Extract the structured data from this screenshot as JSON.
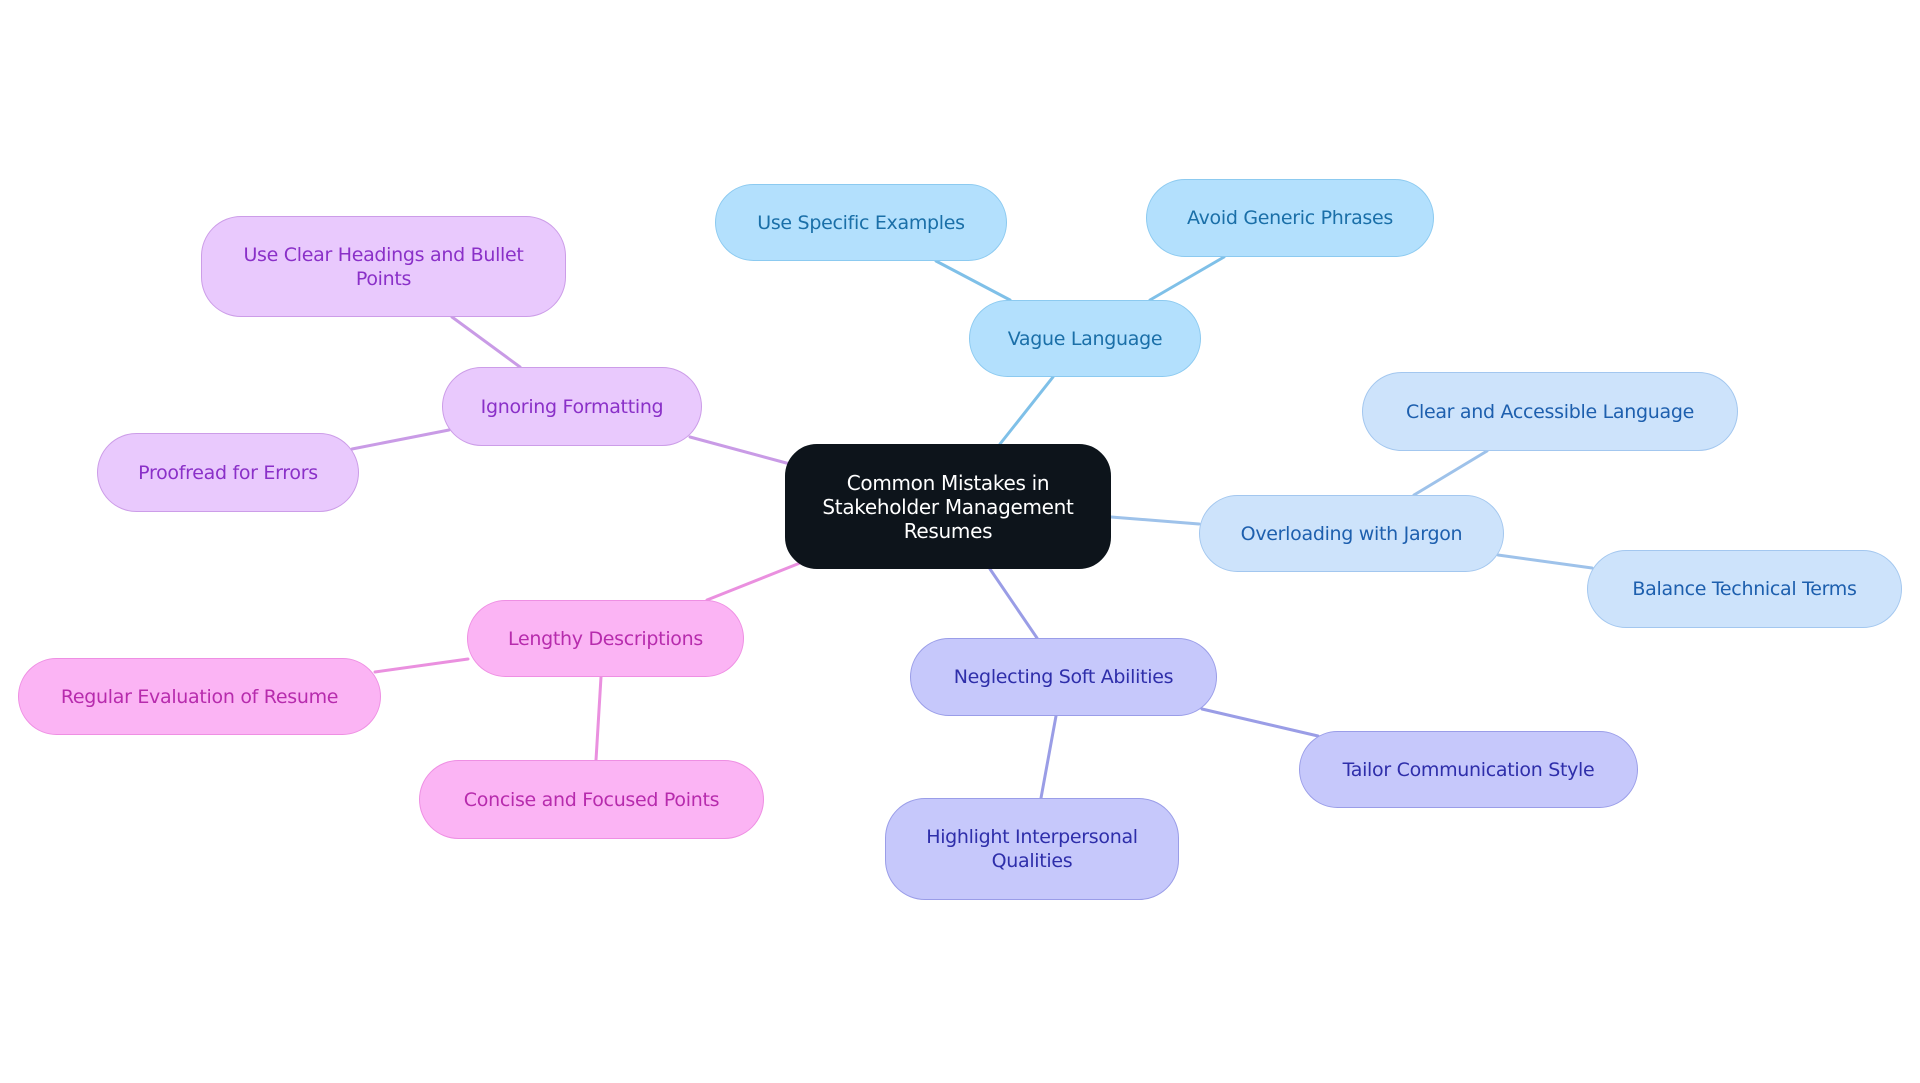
{
  "diagram": {
    "type": "mindmap",
    "root": {
      "id": "root",
      "label": "Common Mistakes in Stakeholder Management Resumes",
      "fill": "#0d141b",
      "text_color": "#ffffff",
      "border": "#0d141b"
    },
    "branches": [
      {
        "id": "vague",
        "label": "Vague Language",
        "fill": "#b3e0fd",
        "border": "#8ccaf0",
        "text_color": "#1a6fa8",
        "edge_color": "#7fc0e8",
        "children": [
          {
            "id": "vague-1",
            "label": "Use Specific Examples"
          },
          {
            "id": "vague-2",
            "label": "Avoid Generic Phrases"
          }
        ]
      },
      {
        "id": "jargon",
        "label": "Overloading with Jargon",
        "fill": "#cde3fb",
        "border": "#a3c7ef",
        "text_color": "#1d5fae",
        "edge_color": "#9ec2ea",
        "children": [
          {
            "id": "jargon-1",
            "label": "Clear and Accessible Language"
          },
          {
            "id": "jargon-2",
            "label": "Balance Technical Terms"
          }
        ]
      },
      {
        "id": "soft",
        "label": "Neglecting Soft Abilities",
        "fill": "#c6c8fb",
        "border": "#9a9de8",
        "text_color": "#2e2eaa",
        "edge_color": "#9a9de6",
        "children": [
          {
            "id": "soft-1",
            "label": "Tailor Communication Style"
          },
          {
            "id": "soft-2",
            "label": "Highlight Interpersonal Qualities"
          }
        ]
      },
      {
        "id": "format",
        "label": "Ignoring Formatting",
        "fill": "#e9c9fd",
        "border": "#cc9de8",
        "text_color": "#8a30c8",
        "edge_color": "#c99be6",
        "children": [
          {
            "id": "format-1",
            "label": "Use Clear Headings and Bullet Points"
          },
          {
            "id": "format-2",
            "label": "Proofread for Errors"
          }
        ]
      },
      {
        "id": "lengthy",
        "label": "Lengthy Descriptions",
        "fill": "#fbb4f4",
        "border": "#ee8fe3",
        "text_color": "#b72bad",
        "edge_color": "#ea90df",
        "children": [
          {
            "id": "lengthy-1",
            "label": "Regular Evaluation of Resume"
          },
          {
            "id": "lengthy-2",
            "label": "Concise and Focused Points"
          }
        ]
      }
    ]
  }
}
